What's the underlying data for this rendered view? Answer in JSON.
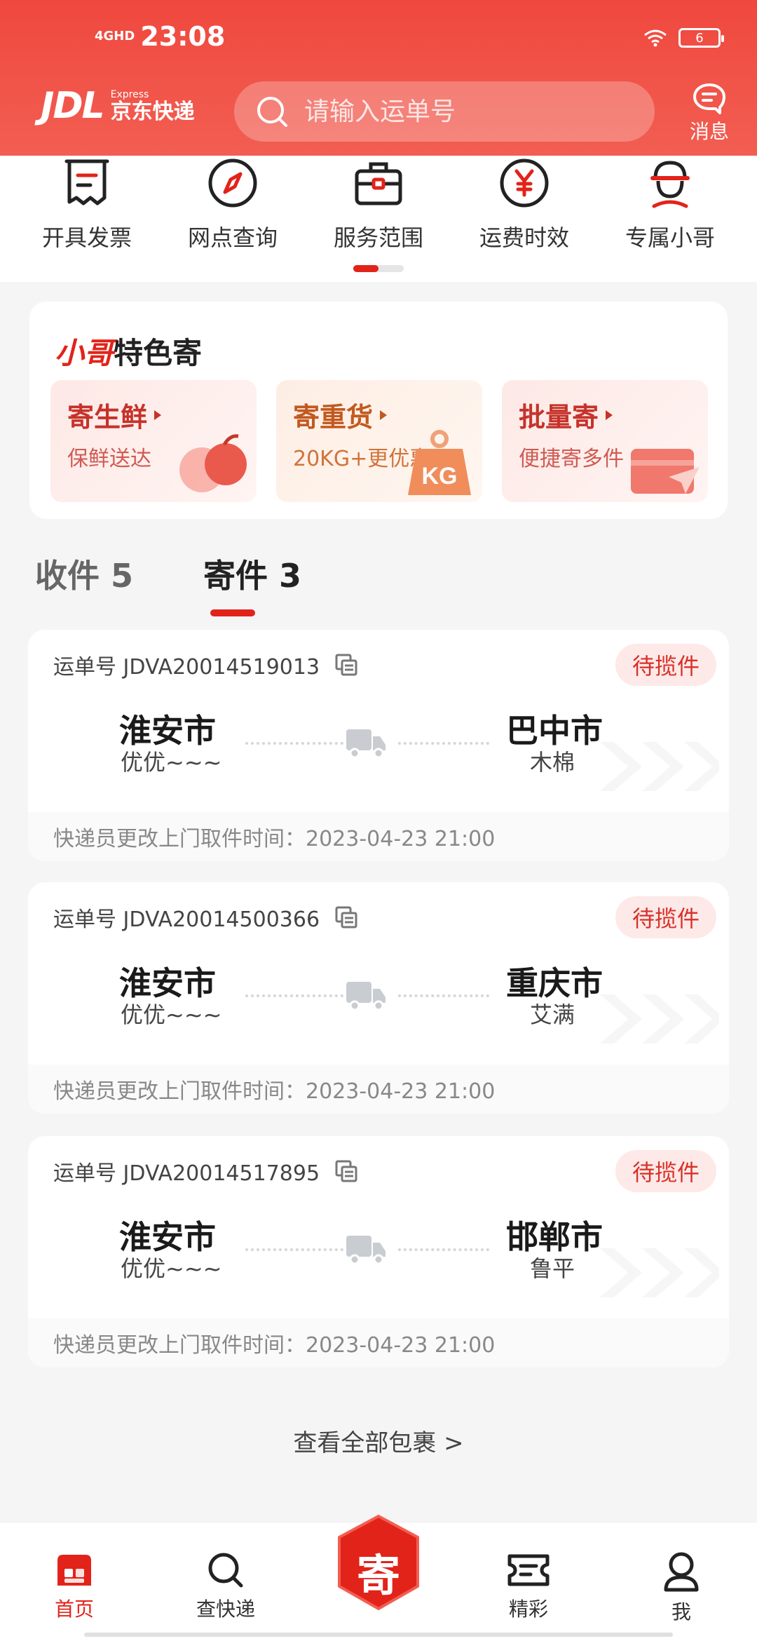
{
  "status_bar": {
    "network": "4GHD",
    "time": "23:08",
    "battery": "6"
  },
  "header": {
    "logo_jdl": "JDL",
    "logo_en": "Express",
    "logo_cn": "京东快递",
    "search_placeholder": "请输入运单号",
    "message_label": "消息"
  },
  "quick_nav": [
    {
      "label": "开具发票",
      "icon": "invoice-icon"
    },
    {
      "label": "网点查询",
      "icon": "compass-icon"
    },
    {
      "label": "服务范围",
      "icon": "briefcase-icon"
    },
    {
      "label": "运费时效",
      "icon": "yuan-icon"
    },
    {
      "label": "专属小哥",
      "icon": "courier-icon"
    }
  ],
  "feature": {
    "title_highlight": "小哥",
    "title_rest": "特色寄",
    "boxes": [
      {
        "title": "寄生鲜",
        "subtitle": "保鲜送达"
      },
      {
        "title": "寄重货",
        "subtitle": "20KG+更优惠",
        "tag": "KG"
      },
      {
        "title": "批量寄",
        "subtitle": "便捷寄多件"
      }
    ]
  },
  "tabs": [
    {
      "label": "收件 5",
      "active": false
    },
    {
      "label": "寄件 3",
      "active": true
    }
  ],
  "shipments": [
    {
      "waybill": "运单号 JDVA20014519013",
      "status": "待揽件",
      "from_city": "淮安市",
      "from_name": "优优~~~",
      "to_city": "巴中市",
      "to_name": "木棉",
      "note": "快递员更改上门取件时间：2023-04-23 21:00"
    },
    {
      "waybill": "运单号 JDVA20014500366",
      "status": "待揽件",
      "from_city": "淮安市",
      "from_name": "优优~~~",
      "to_city": "重庆市",
      "to_name": "艾满",
      "note": "快递员更改上门取件时间：2023-04-23 21:00"
    },
    {
      "waybill": "运单号 JDVA20014517895",
      "status": "待揽件",
      "from_city": "淮安市",
      "from_name": "优优~~~",
      "to_city": "邯郸市",
      "to_name": "鲁平",
      "note": "快递员更改上门取件时间：2023-04-23 21:00"
    }
  ],
  "view_all": "查看全部包裹 >",
  "bottom_nav": {
    "home": "首页",
    "track": "查快递",
    "send": "寄",
    "featured": "精彩",
    "me": "我"
  },
  "colors": {
    "brand_red": "#e2231a",
    "header_red": "#f0483e"
  }
}
